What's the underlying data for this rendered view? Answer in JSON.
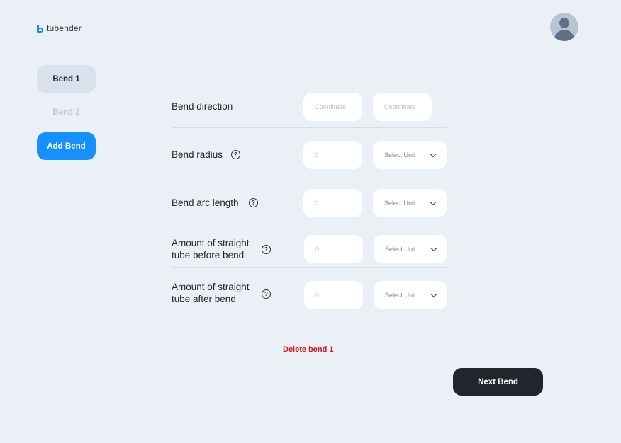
{
  "app": {
    "name": "tubender"
  },
  "sidebar": {
    "items": [
      {
        "label": "Bend 1"
      },
      {
        "label": "Bend 2"
      }
    ],
    "add_label": "Add Bend"
  },
  "form": {
    "bend_direction": {
      "label": "Bend direction",
      "coord1_placeholder": "Coordinate",
      "coord2_placeholder": "Coordinate"
    },
    "bend_radius": {
      "label": "Bend radius",
      "value": "0",
      "unit_placeholder": "Select Unit"
    },
    "arc_length": {
      "label": "Bend arc length",
      "value": "0",
      "unit_placeholder": "Select Unit"
    },
    "straight_before": {
      "label_line1": "Amount of straight",
      "label_line2": "tube before bend",
      "value": "0",
      "unit_placeholder": "Select Unit"
    },
    "straight_after": {
      "label_line1": "Amount of straight",
      "label_line2": "tube after bend",
      "value": "0",
      "unit_placeholder": "Select Unit"
    },
    "help_glyph": "?"
  },
  "actions": {
    "delete_label": "Delete bend 1",
    "next_label": "Next Bend"
  },
  "colors": {
    "accent": "#1591ff",
    "danger": "#d01818",
    "dark_button": "#21252c",
    "background": "#ebf0f6"
  }
}
